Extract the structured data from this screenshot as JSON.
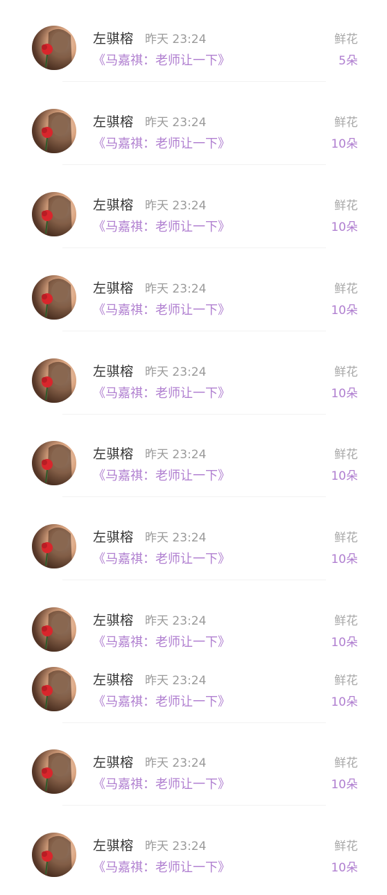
{
  "records": [
    {
      "name": "左骐榕",
      "time": "昨天 23:24",
      "book": "《马嘉祺：老师让一下》",
      "gift_type": "鲜花",
      "gift_count": "5朵"
    },
    {
      "name": "左骐榕",
      "time": "昨天 23:24",
      "book": "《马嘉祺：老师让一下》",
      "gift_type": "鲜花",
      "gift_count": "10朵"
    },
    {
      "name": "左骐榕",
      "time": "昨天 23:24",
      "book": "《马嘉祺：老师让一下》",
      "gift_type": "鲜花",
      "gift_count": "10朵"
    },
    {
      "name": "左骐榕",
      "time": "昨天 23:24",
      "book": "《马嘉祺：老师让一下》",
      "gift_type": "鲜花",
      "gift_count": "10朵"
    },
    {
      "name": "左骐榕",
      "time": "昨天 23:24",
      "book": "《马嘉祺：老师让一下》",
      "gift_type": "鲜花",
      "gift_count": "10朵"
    },
    {
      "name": "左骐榕",
      "time": "昨天 23:24",
      "book": "《马嘉祺：老师让一下》",
      "gift_type": "鲜花",
      "gift_count": "10朵"
    },
    {
      "name": "左骐榕",
      "time": "昨天 23:24",
      "book": "《马嘉祺：老师让一下》",
      "gift_type": "鲜花",
      "gift_count": "10朵"
    },
    {
      "name": "左骐榕",
      "time": "昨天 23:24",
      "book": "《马嘉祺：老师让一下》",
      "gift_type": "鲜花",
      "gift_count": "10朵"
    },
    {
      "name": "左骐榕",
      "time": "昨天 23:24",
      "book": "《马嘉祺：老师让一下》",
      "gift_type": "鲜花",
      "gift_count": "10朵"
    },
    {
      "name": "左骐榕",
      "time": "昨天 23:24",
      "book": "《马嘉祺：老师让一下》",
      "gift_type": "鲜花",
      "gift_count": "10朵"
    },
    {
      "name": "左骐榕",
      "time": "昨天 23:24",
      "book": "《马嘉祺：老师让一下》",
      "gift_type": "鲜花",
      "gift_count": "10朵"
    }
  ],
  "colors": {
    "accent_purple": "#b07fd0",
    "name_text": "#333333",
    "muted_text": "#9a9a9a"
  },
  "icons": {
    "avatar": "user-avatar-photo"
  }
}
